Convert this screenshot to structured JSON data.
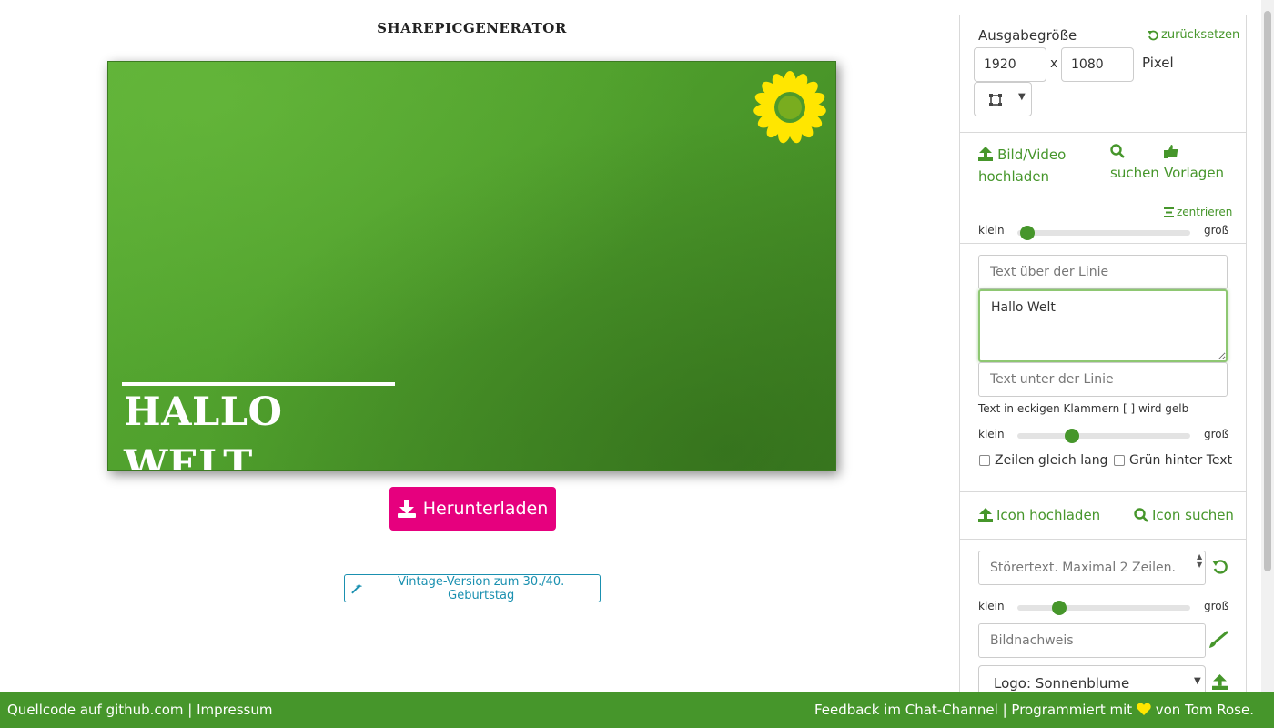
{
  "app": {
    "title": "SHAREPICGENERATOR"
  },
  "canvas": {
    "headline": "HALLO WELT",
    "logo_icon": "sunflower-icon"
  },
  "actions": {
    "download_label": "Herunterladen",
    "vintage_label": "Vintage-Version zum 30./40. Geburtstag"
  },
  "size": {
    "label": "Ausgabegröße",
    "reset_label": "zurücksetzen",
    "width": "1920",
    "separator": "x",
    "height": "1080",
    "unit": "Pixel",
    "format_icon": "crop-icon"
  },
  "image": {
    "upload_label": "Bild/Video hochladen",
    "search_label": "suchen",
    "templates_label": "Vorlagen",
    "center_label": "zentrieren",
    "slider_min": "klein",
    "slider_max": "groß",
    "zoom_level": 0.02
  },
  "text": {
    "above_placeholder": "Text über der Linie",
    "main_value": "Hallo Welt",
    "below_placeholder": "Text unter der Linie",
    "hint": "Text in eckigen Klammern [ ] wird gelb",
    "slider_min": "klein",
    "slider_max": "groß",
    "size_level": 0.3,
    "equal_lines_label": "Zeilen gleich lang",
    "green_behind_label": "Grün hinter Text"
  },
  "icon": {
    "upload_label": "Icon hochladen",
    "search_label": "Icon suchen"
  },
  "stoerer": {
    "placeholder": "Störertext. Maximal 2 Zeilen.",
    "slider_min": "klein",
    "slider_max": "groß",
    "size_level": 0.22,
    "credit_placeholder": "Bildnachweis"
  },
  "logo": {
    "selected": "Logo: Sonnenblume"
  },
  "footer": {
    "source_link": "Quellcode auf github.com",
    "separator": "|",
    "imprint_link": "Impressum",
    "feedback_link": "Feedback im Chat-Channel",
    "programmed_prefix": "Programmiert mit",
    "programmed_suffix": "von Tom Rose."
  },
  "colors": {
    "brand_green": "#46962b",
    "download_magenta": "#e6007e",
    "heart_yellow": "#ffe600"
  }
}
